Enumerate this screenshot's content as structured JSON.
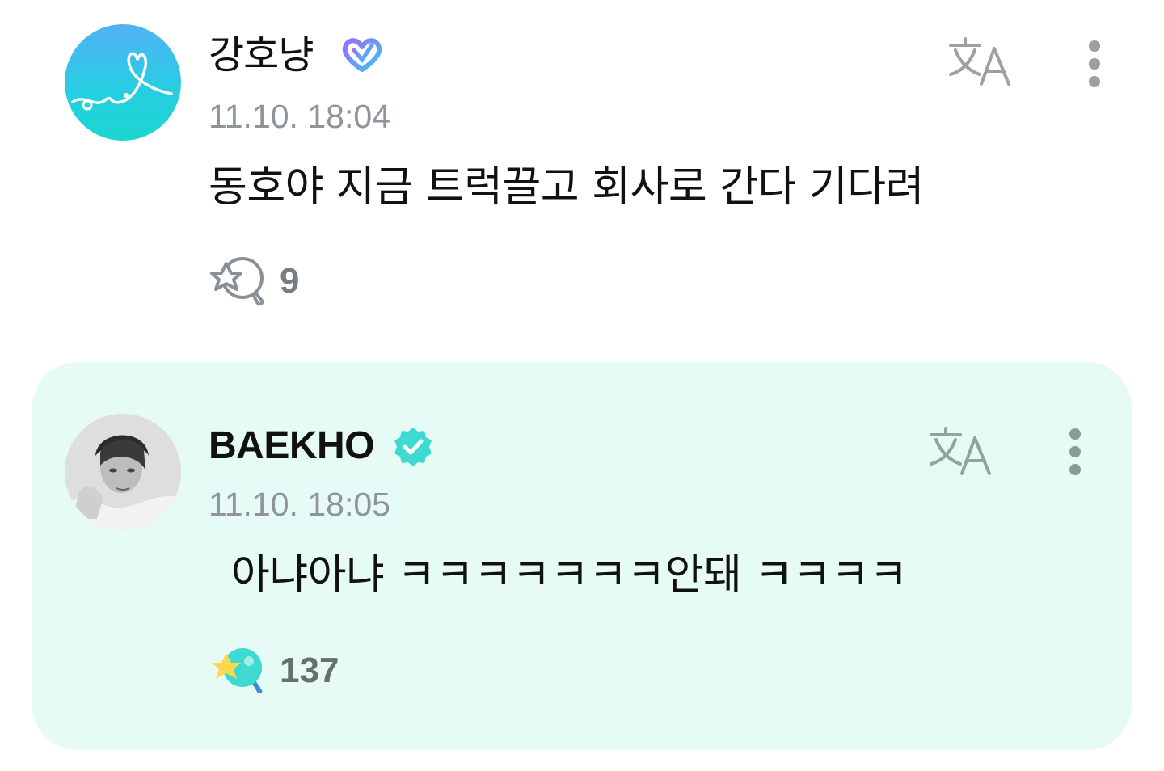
{
  "comments": [
    {
      "author": "강호냥",
      "timestamp": "11.10. 18:04",
      "text": "동호야 지금 트럭끌고 회사로 간다 기다려",
      "reaction_count": "9",
      "badge_icon": "fan-heart-badge-icon",
      "reaction_icon": "star-lollipop-outline-icon"
    },
    {
      "author": "BAEKHO",
      "timestamp": "11.10. 18:05",
      "text": "아냐아냐 ㅋㅋㅋㅋㅋㅋㅋ안돼 ㅋㅋㅋㅋ",
      "reaction_count": "137",
      "badge_icon": "verified-check-badge-icon",
      "reaction_icon": "star-lollipop-filled-icon"
    }
  ],
  "colors": {
    "reply_card_bg": "#e6faf6",
    "accent_teal": "#3ed9d0",
    "timestamp_gray": "#8e9499"
  }
}
